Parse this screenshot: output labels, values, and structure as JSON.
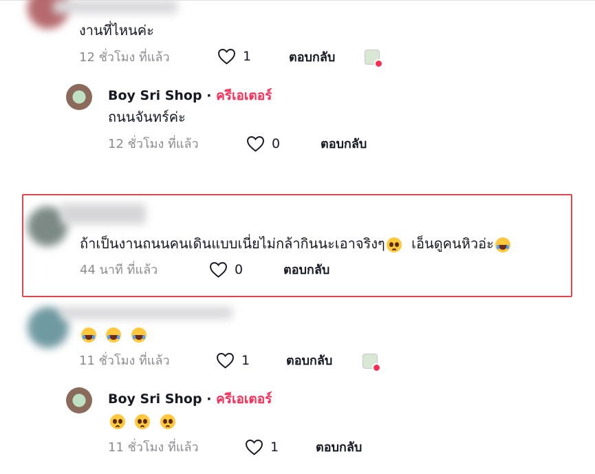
{
  "comments": [
    {
      "text": "งานที่ไหนค่ะ",
      "time": "12 ชั่วโมง ที่แล้ว",
      "likes": "1",
      "reply": "ตอบกลับ"
    },
    {
      "author": "Boy Sri Shop",
      "separator": "·",
      "badge": "ครีเอเตอร์",
      "text": "ถนนจันทร์ค่ะ",
      "time": "12 ชั่วโมง ที่แล้ว",
      "likes": "0",
      "reply": "ตอบกลับ"
    },
    {
      "text": "ถ้าเป็นงานถนนคนเดินแบบเนี่ยไม่กล้ากินนะเอาจริงๆ",
      "text_tail": "เอ็นดูคนหิวอ่ะ",
      "emojis": [
        "pleading-face-emoji",
        "laughing-tears-emoji"
      ],
      "time": "44 นาที ที่แล้ว",
      "likes": "0",
      "reply": "ตอบกลับ"
    },
    {
      "emojis": [
        "laughing-tears-emoji",
        "laughing-tears-emoji",
        "laughing-tears-emoji"
      ],
      "time": "11 ชั่วโมง ที่แล้ว",
      "likes": "1",
      "reply": "ตอบกลับ"
    },
    {
      "author": "Boy Sri Shop",
      "separator": "·",
      "badge": "ครีเอเตอร์",
      "emojis": [
        "pleading-face-emoji",
        "pleading-face-emoji",
        "pleading-face-emoji"
      ],
      "time": "11 ชั่วโมง ที่แล้ว",
      "likes": "1",
      "reply": "ตอบกลับ"
    }
  ],
  "colors": {
    "creator_badge": "#fe2c55",
    "meta_text": "#8a8b91",
    "highlight_border": "#e0464a"
  }
}
